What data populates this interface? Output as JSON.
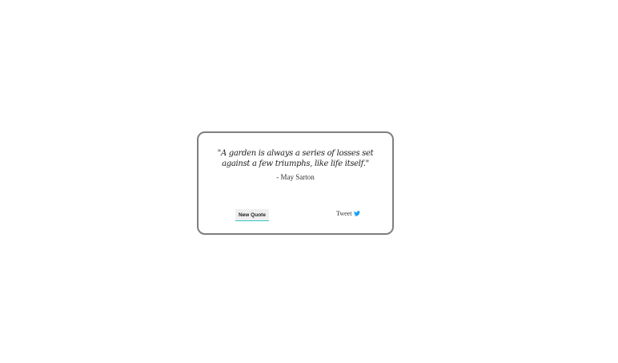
{
  "quote": {
    "text": "\"A garden is always a series of losses set against a few triumphs, like life itself.\"",
    "author": "- May Sarton"
  },
  "actions": {
    "new_quote_label": "New Quote",
    "tweet_label": "Tweet",
    "tweet_icon": "twitter-bird-icon"
  },
  "colors": {
    "card_border": "#7f7f7f",
    "button_background": "#efefef",
    "button_accent": "#37c5c0",
    "twitter_blue": "#1da1f2"
  }
}
